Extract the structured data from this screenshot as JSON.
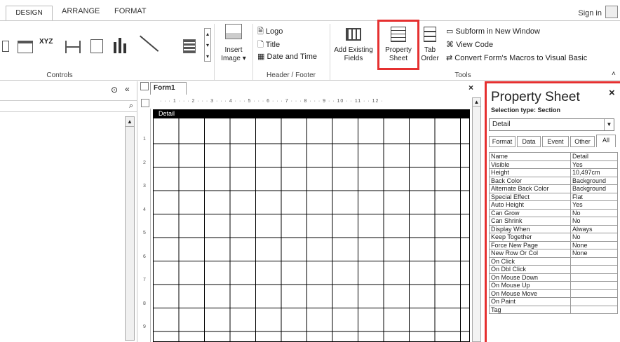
{
  "tabs": {
    "design": "DESIGN",
    "arrange": "ARRANGE",
    "format": "FORMAT"
  },
  "signin": "Sign in",
  "ribbon": {
    "controls_label": "Controls",
    "insert_image": [
      "Insert",
      "Image ▾"
    ],
    "header_footer": {
      "label": "Header / Footer",
      "logo": "Logo",
      "title": "Title",
      "date_time": "Date and Time"
    },
    "tools": {
      "label": "Tools",
      "add_existing": [
        "Add Existing",
        "Fields"
      ],
      "property_sheet": [
        "Property",
        "Sheet"
      ],
      "tab_order": [
        "Tab",
        "Order"
      ],
      "subform": "Subform in New Window",
      "view_code": "View Code",
      "convert_macros": "Convert Form's Macros to Visual Basic"
    }
  },
  "document": {
    "tab": "Form1",
    "detail_label": "Detail",
    "ruler_h": "· · · 1 · · · 2 · · · 3 · · · 4 · · · 5 · · · 6 · · · 7 · · · 8 · · · 9 · · 10 · · 11 · · 12 ·",
    "ruler_v": [
      "1",
      "2",
      "3",
      "4",
      "5",
      "6",
      "7",
      "8",
      "9"
    ]
  },
  "property_sheet": {
    "title": "Property Sheet",
    "selection_type": "Selection type:  Section",
    "selected_object": "Detail",
    "tabs": [
      "Format",
      "Data",
      "Event",
      "Other",
      "All"
    ],
    "active_tab": "All",
    "rows": [
      {
        "name": "Name",
        "value": "Detail"
      },
      {
        "name": "Visible",
        "value": "Yes"
      },
      {
        "name": "Height",
        "value": "10,497cm"
      },
      {
        "name": "Back Color",
        "value": "Background"
      },
      {
        "name": "Alternate Back Color",
        "value": "Background"
      },
      {
        "name": "Special Effect",
        "value": "Flat"
      },
      {
        "name": "Auto Height",
        "value": "Yes"
      },
      {
        "name": "Can Grow",
        "value": "No"
      },
      {
        "name": "Can Shrink",
        "value": "No"
      },
      {
        "name": "Display When",
        "value": "Always"
      },
      {
        "name": "Keep Together",
        "value": "No"
      },
      {
        "name": "Force New Page",
        "value": "None"
      },
      {
        "name": "New Row Or Col",
        "value": "None"
      },
      {
        "name": "On Click",
        "value": ""
      },
      {
        "name": "On Dbl Click",
        "value": ""
      },
      {
        "name": "On Mouse Down",
        "value": ""
      },
      {
        "name": "On Mouse Up",
        "value": ""
      },
      {
        "name": "On Mouse Move",
        "value": ""
      },
      {
        "name": "On Paint",
        "value": ""
      },
      {
        "name": "Tag",
        "value": ""
      }
    ]
  },
  "colors": {
    "highlight": "#e53030"
  }
}
